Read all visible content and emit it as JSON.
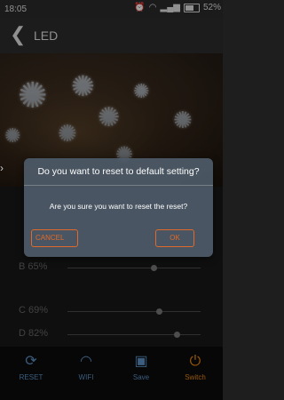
{
  "status_bar": {
    "time": "18:05",
    "battery_text": "52%"
  },
  "header": {
    "title": "LED"
  },
  "sliders": [
    {
      "label": "B 65%",
      "value": 0.65
    },
    {
      "label": "C 69%",
      "value": 0.69
    },
    {
      "label": "D 82%",
      "value": 0.82
    }
  ],
  "tabs": [
    {
      "label": "RESET",
      "icon": "reset-icon",
      "color": "#5b8fc4"
    },
    {
      "label": "WIFI",
      "icon": "wifi-icon",
      "color": "#5b8fc4"
    },
    {
      "label": "Save",
      "icon": "save-icon",
      "color": "#5b8fc4"
    },
    {
      "label": "Switch",
      "icon": "power-icon",
      "color": "#e8870e"
    }
  ],
  "dialog": {
    "title": "Do you want to reset to default setting?",
    "message": "Are you sure you want to reset the reset?",
    "cancel_label": "CANCEL",
    "ok_label": "OK"
  },
  "colors": {
    "accent": "#e06a2a",
    "dialog_bg": "#4e5a68"
  }
}
